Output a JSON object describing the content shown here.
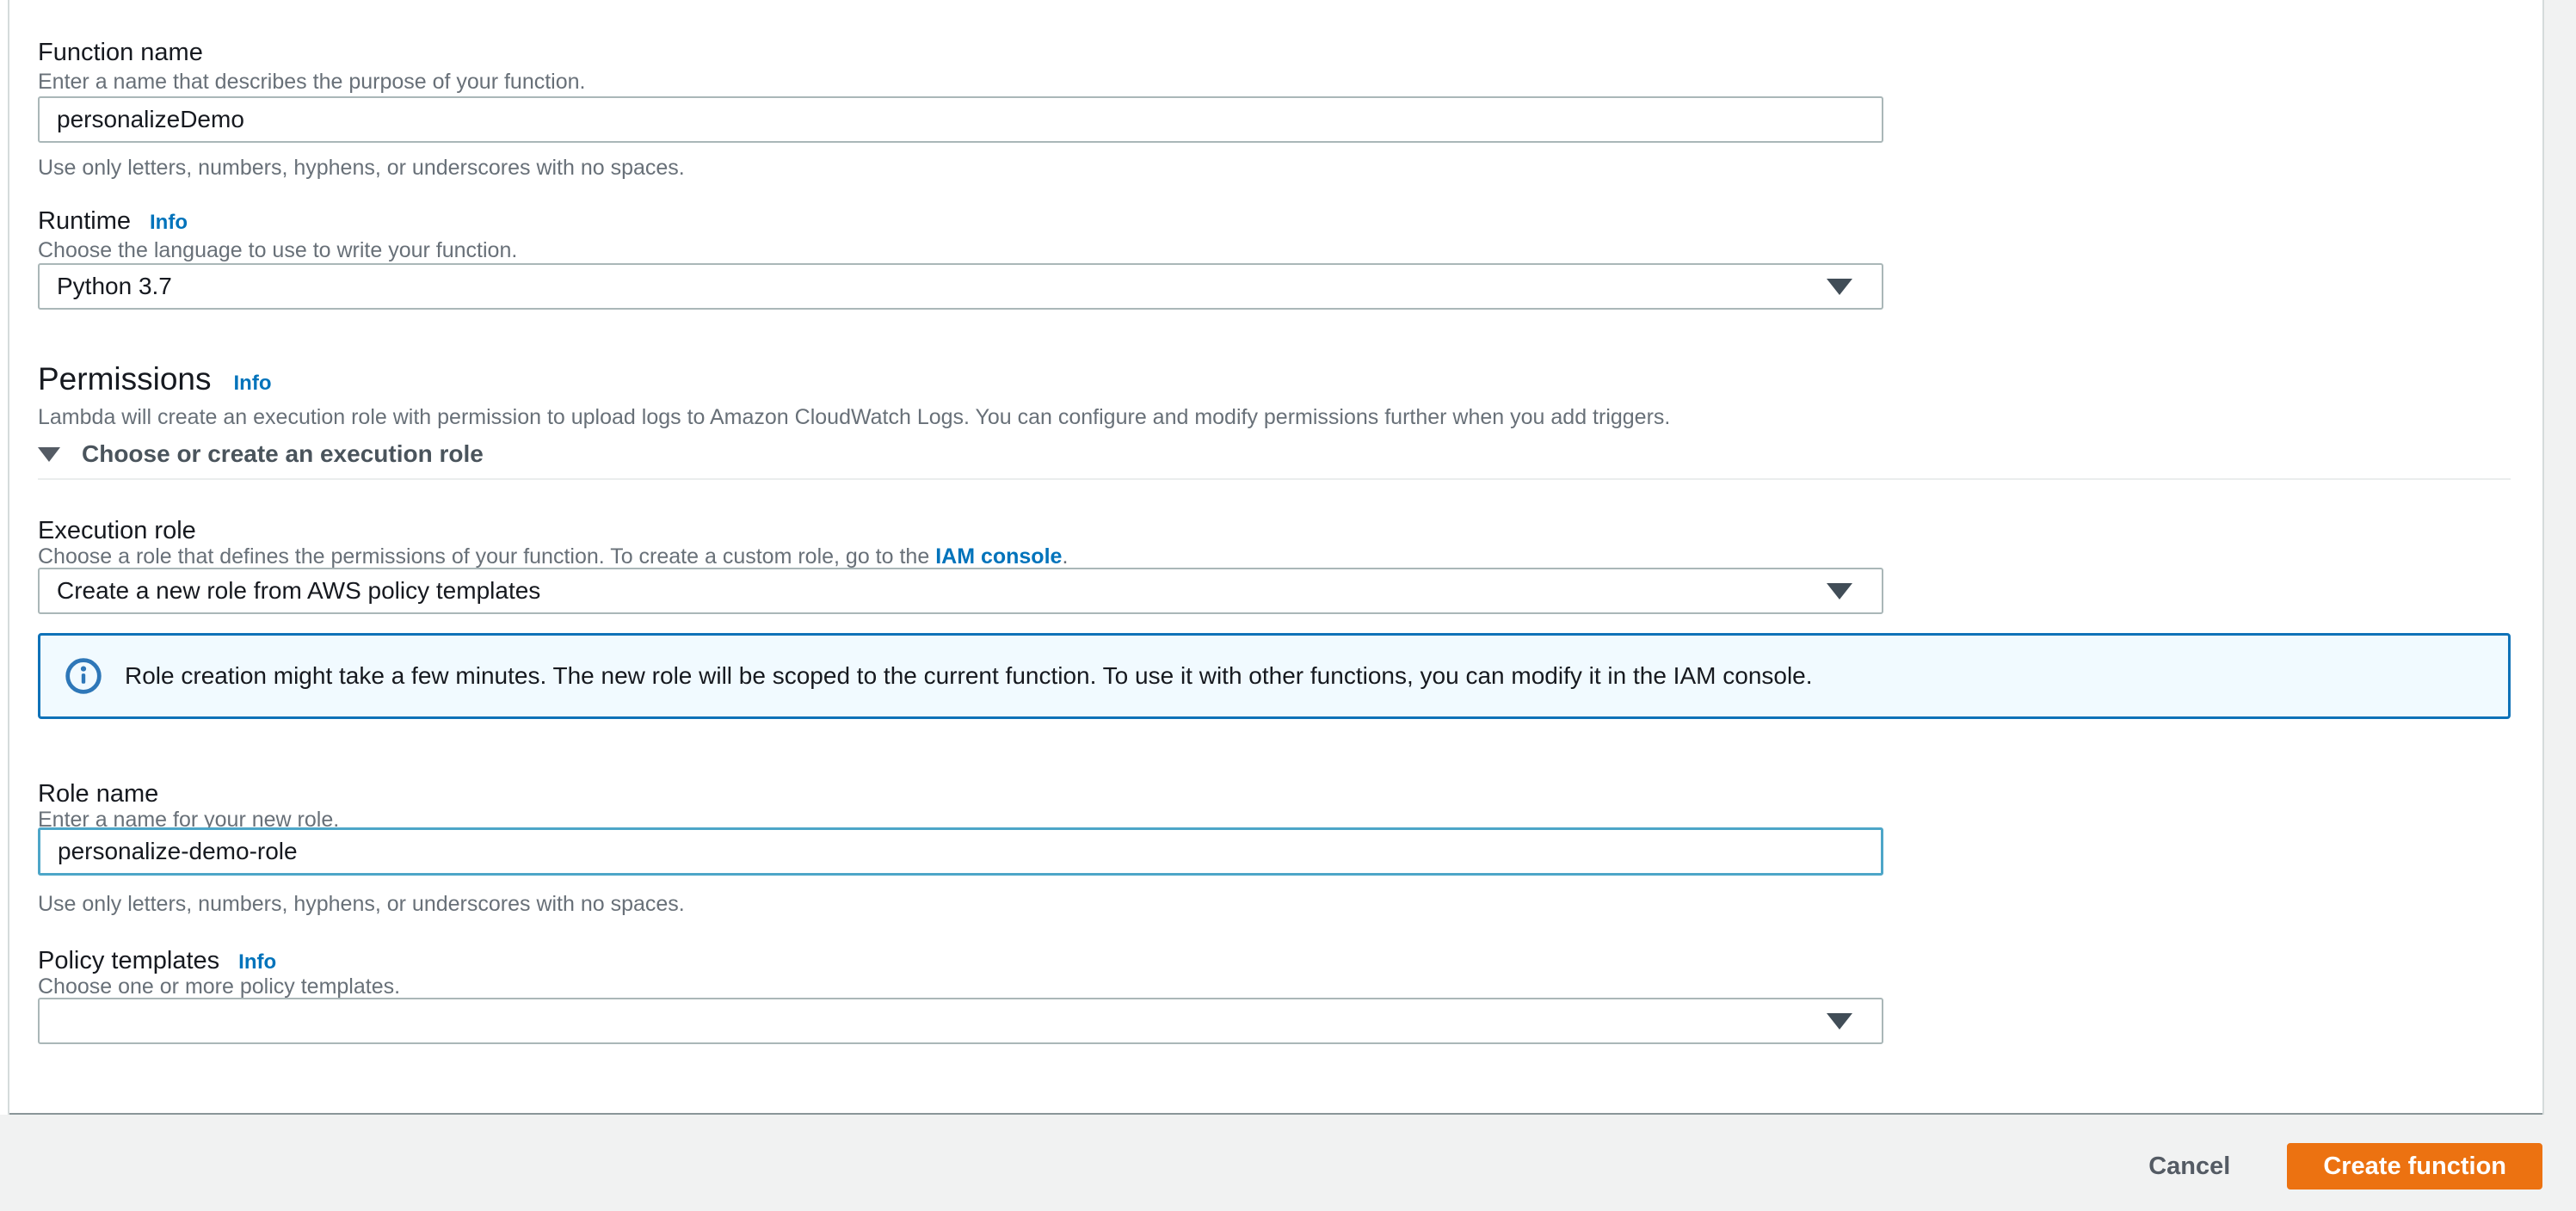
{
  "form": {
    "function_name": {
      "label": "Function name",
      "description": "Enter a name that describes the purpose of your function.",
      "value": "personalizeDemo",
      "hint": "Use only letters, numbers, hyphens, or underscores with no spaces."
    },
    "runtime": {
      "label": "Runtime",
      "info_label": "Info",
      "description": "Choose the language to use to write your function.",
      "value": "Python 3.7"
    },
    "permissions": {
      "heading": "Permissions",
      "info_label": "Info",
      "description": "Lambda will create an execution role with permission to upload logs to Amazon CloudWatch Logs. You can configure and modify permissions further when you add triggers.",
      "expander_label": "Choose or create an execution role"
    },
    "execution_role": {
      "label": "Execution role",
      "description_before_link": "Choose a role that defines the permissions of your function. To create a custom role, go to the ",
      "link_text": "IAM console",
      "description_after_link": ".",
      "value": "Create a new role from AWS policy templates"
    },
    "alert": {
      "text": "Role creation might take a few minutes. The new role will be scoped to the current function. To use it with other functions, you can modify it in the IAM console."
    },
    "role_name": {
      "label": "Role name",
      "description": "Enter a name for your new role.",
      "value": "personalize-demo-role",
      "hint": "Use only letters, numbers, hyphens, or underscores with no spaces."
    },
    "policy_templates": {
      "label": "Policy templates",
      "info_label": "Info",
      "description": "Choose one or more policy templates.",
      "value": ""
    }
  },
  "footer": {
    "cancel_label": "Cancel",
    "submit_label": "Create function"
  },
  "colors": {
    "primary_button": "#ec7211",
    "link_blue": "#0073bb",
    "alert_border": "#0f72b8",
    "alert_background": "#f1faff",
    "focus_border": "#4da6c8",
    "control_border": "#aab7b8",
    "text_primary": "#16191f",
    "text_secondary": "#687078",
    "footer_background": "#f1f2f2"
  }
}
